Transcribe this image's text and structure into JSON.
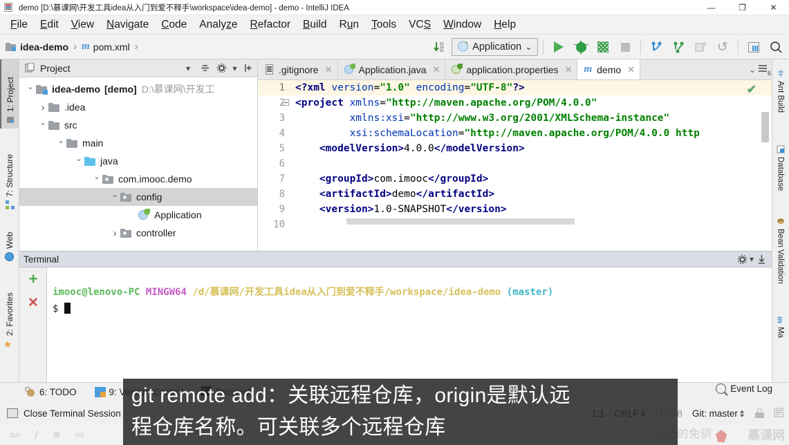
{
  "window": {
    "title": "demo [D:\\慕课网\\开发工具idea从入门到爱不释手\\workspace\\idea-demo] - demo - IntelliJ IDEA",
    "app_icon": "intellij-idea-icon",
    "minimize": "—",
    "maximize": "❐",
    "close": "✕"
  },
  "menubar": {
    "items": [
      {
        "label": "File",
        "mnemonic": "F"
      },
      {
        "label": "Edit",
        "mnemonic": "E"
      },
      {
        "label": "View",
        "mnemonic": "V"
      },
      {
        "label": "Navigate",
        "mnemonic": "N"
      },
      {
        "label": "Code",
        "mnemonic": "C"
      },
      {
        "label": "Analyze",
        "mnemonic": "z"
      },
      {
        "label": "Refactor",
        "mnemonic": "R"
      },
      {
        "label": "Build",
        "mnemonic": "B"
      },
      {
        "label": "Run",
        "mnemonic": "u"
      },
      {
        "label": "Tools",
        "mnemonic": "T"
      },
      {
        "label": "VCS",
        "mnemonic": "S"
      },
      {
        "label": "Window",
        "mnemonic": "W"
      },
      {
        "label": "Help",
        "mnemonic": "H"
      }
    ]
  },
  "breadcrumb": {
    "project": "idea-demo",
    "file": "pom.xml",
    "separator": "›"
  },
  "toolbar": {
    "update_icon": "update-project-icon",
    "run_config": "Application",
    "run_config_caret": "⌄",
    "run": "run-icon",
    "debug": "debug-icon",
    "coverage": "run-with-coverage-icon",
    "stop": "stop-icon",
    "update_project": "vcs-update-icon",
    "commit": "vcs-commit-icon",
    "push": "vcs-push-icon",
    "rollback": "vcs-rollback-icon",
    "database": "database-icon",
    "search": "search-everywhere-icon"
  },
  "left_strip": {
    "tabs": [
      {
        "label": "1: Project",
        "mnemonic": "1",
        "icon": "project-icon",
        "selected": true
      },
      {
        "label": "7: Structure",
        "mnemonic": "7",
        "icon": "structure-icon",
        "selected": false
      },
      {
        "label": "Web",
        "mnemonic": "",
        "icon": "web-icon",
        "selected": false
      },
      {
        "label": "2: Favorites",
        "mnemonic": "2",
        "icon": "favorites-star-icon",
        "selected": false
      }
    ]
  },
  "right_strip": {
    "tabs": [
      {
        "label": "Ant Build",
        "icon": "ant-build-icon"
      },
      {
        "label": "Database",
        "icon": "database-icon"
      },
      {
        "label": "Bean Validation",
        "icon": "bean-validation-icon"
      },
      {
        "label": "Ma",
        "icon": "maven-icon"
      }
    ]
  },
  "project_window": {
    "title": "Project",
    "icons": [
      "project-view-icon",
      "collapse-dropdown-icon",
      "scroll-from-source-icon",
      "settings-gear-icon",
      "hide-icon"
    ],
    "tree": [
      {
        "indent": 0,
        "arrow": "down",
        "icon": "project-folder",
        "label": "idea-demo",
        "bold_suffix": "[demo]",
        "path": "D:\\慕课网\\开发工",
        "selected": false
      },
      {
        "indent": 1,
        "arrow": "right",
        "icon": "folder",
        "label": ".idea",
        "bold_suffix": "",
        "path": "",
        "selected": false
      },
      {
        "indent": 1,
        "arrow": "down",
        "icon": "folder",
        "label": "src",
        "bold_suffix": "",
        "path": "",
        "selected": false
      },
      {
        "indent": 2,
        "arrow": "down",
        "icon": "folder",
        "label": "main",
        "bold_suffix": "",
        "path": "",
        "selected": false
      },
      {
        "indent": 3,
        "arrow": "down",
        "icon": "source-folder",
        "label": "java",
        "bold_suffix": "",
        "path": "",
        "selected": false
      },
      {
        "indent": 4,
        "arrow": "down",
        "icon": "package-folder",
        "label": "com.imooc.demo",
        "bold_suffix": "",
        "path": "",
        "selected": false
      },
      {
        "indent": 5,
        "arrow": "down",
        "icon": "package-folder",
        "label": "config",
        "bold_suffix": "",
        "path": "",
        "selected": true
      },
      {
        "indent": 6,
        "arrow": "none",
        "icon": "spring-class",
        "label": "Application",
        "bold_suffix": "",
        "path": "",
        "selected": false
      },
      {
        "indent": 5,
        "arrow": "right",
        "icon": "package-folder",
        "label": "controller",
        "bold_suffix": "",
        "path": "",
        "selected": false
      }
    ]
  },
  "editor_tabs": {
    "tabs": [
      {
        "label": ".gitignore",
        "icon": "gitignore-file-icon",
        "active": false,
        "close": "✕"
      },
      {
        "label": "Application.java",
        "icon": "spring-java-icon",
        "active": false,
        "close": "✕"
      },
      {
        "label": "application.properties",
        "icon": "spring-properties-icon",
        "active": false,
        "close": "✕"
      },
      {
        "label": "demo",
        "icon": "maven-pom-icon",
        "active": true,
        "close": "✕"
      }
    ],
    "dropdown": "⌄",
    "list_icon": "tab-list-icon",
    "list_badge": "6"
  },
  "editor": {
    "inspection_status": "✔",
    "lines": [
      {
        "num": "1",
        "current": true,
        "fold": false,
        "tokens": [
          {
            "t": "<?xml ",
            "c": "pi"
          },
          {
            "t": "version",
            "c": "attr"
          },
          {
            "t": "=",
            "c": "txt"
          },
          {
            "t": "\"1.0\"",
            "c": "str"
          },
          {
            "t": " ",
            "c": "txt"
          },
          {
            "t": "encoding",
            "c": "attr"
          },
          {
            "t": "=",
            "c": "txt"
          },
          {
            "t": "\"UTF-8\"",
            "c": "str"
          },
          {
            "t": "?>",
            "c": "pi"
          }
        ]
      },
      {
        "num": "2",
        "current": false,
        "fold": true,
        "tokens": [
          {
            "t": "<project ",
            "c": "tag"
          },
          {
            "t": "xmlns",
            "c": "attr"
          },
          {
            "t": "=",
            "c": "txt"
          },
          {
            "t": "\"http://maven.apache.org/POM/4.0.0\"",
            "c": "str"
          }
        ]
      },
      {
        "num": "3",
        "current": false,
        "fold": false,
        "tokens": [
          {
            "t": "         ",
            "c": "txt"
          },
          {
            "t": "xmlns:xsi",
            "c": "attr"
          },
          {
            "t": "=",
            "c": "txt"
          },
          {
            "t": "\"http://www.w3.org/2001/XMLSchema-instance\"",
            "c": "str"
          }
        ]
      },
      {
        "num": "4",
        "current": false,
        "fold": false,
        "tokens": [
          {
            "t": "         ",
            "c": "txt"
          },
          {
            "t": "xsi:schemaLocation",
            "c": "attr"
          },
          {
            "t": "=",
            "c": "txt"
          },
          {
            "t": "\"http://maven.apache.org/POM/4.0.0 http",
            "c": "str"
          }
        ]
      },
      {
        "num": "5",
        "current": false,
        "fold": false,
        "tokens": [
          {
            "t": "    ",
            "c": "txt"
          },
          {
            "t": "<modelVersion>",
            "c": "tag"
          },
          {
            "t": "4.0.0",
            "c": "txt"
          },
          {
            "t": "</modelVersion>",
            "c": "tag"
          }
        ]
      },
      {
        "num": "6",
        "current": false,
        "fold": false,
        "tokens": []
      },
      {
        "num": "7",
        "current": false,
        "fold": false,
        "tokens": [
          {
            "t": "    ",
            "c": "txt"
          },
          {
            "t": "<groupId>",
            "c": "tag"
          },
          {
            "t": "com.imooc",
            "c": "txt"
          },
          {
            "t": "</groupId>",
            "c": "tag"
          }
        ]
      },
      {
        "num": "8",
        "current": false,
        "fold": false,
        "tokens": [
          {
            "t": "    ",
            "c": "txt"
          },
          {
            "t": "<artifactId>",
            "c": "tag"
          },
          {
            "t": "demo",
            "c": "txt"
          },
          {
            "t": "</artifactId>",
            "c": "tag"
          }
        ]
      },
      {
        "num": "9",
        "current": false,
        "fold": false,
        "tokens": [
          {
            "t": "    ",
            "c": "txt"
          },
          {
            "t": "<version>",
            "c": "tag"
          },
          {
            "t": "1.0-SNAPSHOT",
            "c": "txt"
          },
          {
            "t": "</version>",
            "c": "tag"
          }
        ]
      },
      {
        "num": "10",
        "current": false,
        "fold": false,
        "tokens": []
      }
    ]
  },
  "terminal": {
    "title": "Terminal",
    "new_session": "+",
    "close_session": "✕",
    "settings_icon": "settings-gear-icon",
    "hide_icon": "hide-panel-icon",
    "prompt_user": "imooc@lenovo-PC",
    "prompt_shell": "MINGW64",
    "prompt_path": "/d/慕课网/开发工具idea从入门到爱不释手/workspace/idea-demo",
    "prompt_branch": "(master)",
    "prompt_symbol": "$"
  },
  "bottom_strip": {
    "tabs": [
      {
        "label": "6: TODO",
        "mnemonic": "6",
        "icon": "todo-icon"
      },
      {
        "label": "9: Version Control",
        "mnemonic": "9",
        "icon": "version-control-icon"
      },
      {
        "label": "Terminal",
        "mnemonic": "",
        "icon": "terminal-icon"
      }
    ],
    "event_log": "Event Log",
    "event_log_icon": "event-log-icon"
  },
  "status_bar": {
    "left_text": "Close Terminal Session",
    "left_icon": "terminal-session-icon",
    "caret": "1:1",
    "line_sep": "CRLF",
    "encoding": "UTF-8",
    "git_branch": "Git: master",
    "lock_icon": "read-only-lock-icon",
    "ide_icon": "ide-status-icon"
  },
  "subtitle": {
    "line1": "git remote add：关联远程仓库，origin是默认远",
    "line2": "程仓库名称。可关联多个远程仓库"
  },
  "watermark": {
    "csdn": "CSDN @狂野的免驯",
    "imooc": "慕课网"
  },
  "colors": {
    "accent_blue": "#4a9ede",
    "run_green": "#4caf50",
    "selection_gray": "#d4d4d4",
    "string_green": "#008000",
    "tag_navy": "#000080",
    "subtitle_bg": "#282828"
  }
}
